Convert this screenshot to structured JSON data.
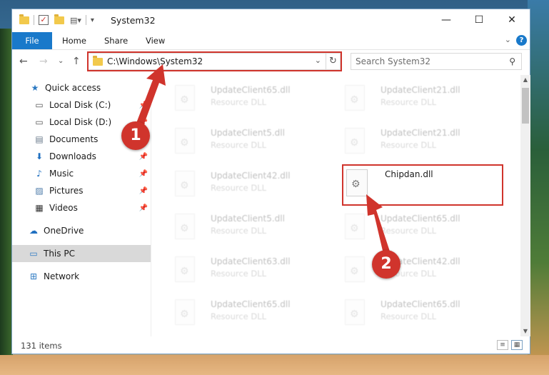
{
  "window": {
    "title": "System32",
    "controls": {
      "minimize": "—",
      "maximize": "☐",
      "close": "✕"
    }
  },
  "ribbon": {
    "tabs": [
      "File",
      "Home",
      "Share",
      "View"
    ]
  },
  "navigation": {
    "address": "C:\\Windows\\System32",
    "search_placeholder": "Search System32"
  },
  "sidebar": {
    "items": [
      {
        "label": "Quick access",
        "icon": "star-icon",
        "pinned": false
      },
      {
        "label": "Local Disk (C:)",
        "icon": "drive-icon",
        "pinned": true
      },
      {
        "label": "Local Disk (D:)",
        "icon": "drive-icon",
        "pinned": true
      },
      {
        "label": "Documents",
        "icon": "documents-icon",
        "pinned": true
      },
      {
        "label": "Downloads",
        "icon": "download-icon",
        "pinned": true
      },
      {
        "label": "Music",
        "icon": "music-icon",
        "pinned": true
      },
      {
        "label": "Pictures",
        "icon": "pictures-icon",
        "pinned": true
      },
      {
        "label": "Videos",
        "icon": "videos-icon",
        "pinned": true
      },
      {
        "label": "OneDrive",
        "icon": "cloud-icon",
        "pinned": false
      },
      {
        "label": "This PC",
        "icon": "computer-icon",
        "pinned": false,
        "selected": true
      },
      {
        "label": "Network",
        "icon": "network-icon",
        "pinned": false
      }
    ]
  },
  "files": {
    "left_column": [
      {
        "name": "UpdateClient65.dll",
        "type": "Resource DLL"
      },
      {
        "name": "UpdateClient5.dll",
        "type": "Resource DLL"
      },
      {
        "name": "UpdateClient42.dll",
        "type": "Resource DLL"
      },
      {
        "name": "UpdateClient5.dll",
        "type": "Resource DLL"
      },
      {
        "name": "UpdateClient63.dll",
        "type": "Resource DLL"
      },
      {
        "name": "UpdateClient65.dll",
        "type": "Resource DLL"
      }
    ],
    "right_column": [
      {
        "name": "UpdateClient21.dll",
        "type": "Resource DLL"
      },
      {
        "name": "UpdateClient21.dll",
        "type": "Resource DLL"
      },
      {
        "name": "Chipdan.dll",
        "type": "",
        "highlighted": true
      },
      {
        "name": "UpdateClient65.dll",
        "type": "Resource DLL"
      },
      {
        "name": "UpdateClient42.dll",
        "type": "Resource DLL"
      },
      {
        "name": "UpdateClient65.dll",
        "type": "Resource DLL"
      }
    ]
  },
  "status": {
    "item_count": "131 items"
  },
  "callouts": [
    "1",
    "2"
  ],
  "colors": {
    "accent": "#1979ca",
    "highlight": "#d0342c"
  }
}
